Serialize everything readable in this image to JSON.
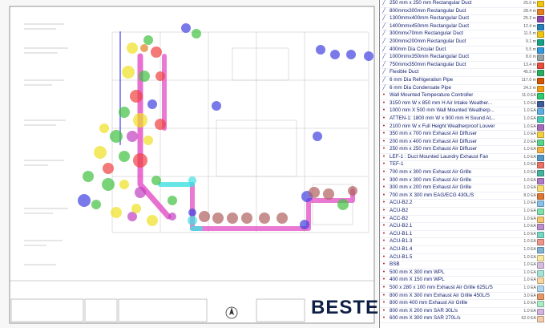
{
  "drawing": {
    "brand": "BESTE",
    "icons": [
      "north-arrow-icon"
    ],
    "marker_colors": [
      "#f0e020",
      "#f04040",
      "#40c040",
      "#4040e0",
      "#c040c0",
      "#40e0e0",
      "#e08020",
      "#a0a0a0",
      "#b06060"
    ]
  },
  "panel": {
    "items": [
      {
        "type": "line",
        "label": "250 mm x 250 mm Rectangular Duct",
        "qty": "25.0 m",
        "color": "#f1c40f"
      },
      {
        "type": "line",
        "label": "800mmx300mm Rectangular Duct",
        "qty": "28.4 m",
        "color": "#e67e22"
      },
      {
        "type": "line",
        "label": "1300mmx400mm Rectangular Duct",
        "qty": "25.3 m",
        "color": "#8e44ad"
      },
      {
        "type": "line",
        "label": "1400mmx450mm Rectangular Duct",
        "qty": "12.4 m",
        "color": "#2980b9"
      },
      {
        "type": "line",
        "label": "300mmx70mm Rectangular Duct",
        "qty": "11.5 m",
        "color": "#f1c40f"
      },
      {
        "type": "line",
        "label": "200mmx200mm Rectangular Duct",
        "qty": "9.1 m",
        "color": "#16a085"
      },
      {
        "type": "line",
        "label": "400mm Dia Circular Duct",
        "qty": "5.5 m",
        "color": "#3498db"
      },
      {
        "type": "line",
        "label": "1000mmx350mm Rectangular Duct",
        "qty": "8.0 m",
        "color": "#95a5a6"
      },
      {
        "type": "line",
        "label": "750mmx350mm Rectangular Duct",
        "qty": "13.4 m",
        "color": "#e74c3c"
      },
      {
        "type": "line",
        "label": "Flexible Duct",
        "qty": "45.5 m",
        "color": "#27ae60"
      },
      {
        "type": "line",
        "label": "6 mm Dia Refrigeration  Pipe",
        "qty": "117.0 m",
        "color": "#d35400"
      },
      {
        "type": "line",
        "label": "6 mm Dia Condensate Pipe",
        "qty": "24.2 m",
        "color": "#f39c12"
      },
      {
        "type": "count",
        "label": "Wall Mounted Temperature Controller",
        "qty": "11.0 EA",
        "color": "#2ecc71"
      },
      {
        "type": "count",
        "label": "3150 mm W x 850 mm H Air Intake Weather...",
        "qty": "1.0 EA",
        "color": "#3d5a99"
      },
      {
        "type": "count",
        "label": "1000 mm X 500 mm Wall Mounted Weatherp...",
        "qty": "1.0 EA",
        "color": "#5dade2"
      },
      {
        "type": "count",
        "label": "ATTEN-1: 1800 mm W x 900 mm H Sound At...",
        "qty": "1.0 EA",
        "color": "#48c9b0"
      },
      {
        "type": "count",
        "label": "2100 mm W x Full Height Weatherproof Louver",
        "qty": "1.0 EA",
        "color": "#a569bd"
      },
      {
        "type": "count",
        "label": "350 mm x 700 mm  Exhaust Air Diffuser",
        "qty": "1.0 EA",
        "color": "#f4d03f"
      },
      {
        "type": "count",
        "label": "200 mm x 400 mm  Exhaust Air Diffuser",
        "qty": "2.0 EA",
        "color": "#58d68d"
      },
      {
        "type": "count",
        "label": "250 mm x 250 mm  Exhaust Air Diffuser",
        "qty": "1.0 EA",
        "color": "#f5b041"
      },
      {
        "type": "count",
        "label": "LEF-1 : Duct Mounted Laundry Exhaust Fan",
        "qty": "1.0 EA",
        "color": "#5499c7"
      },
      {
        "type": "count",
        "label": "TEF-1",
        "qty": "1.0 EA",
        "color": "#ec7063"
      },
      {
        "type": "count",
        "label": "700 mm  x 300 mm  Exhaust Air Grille",
        "qty": "1.0 EA",
        "color": "#45b39d"
      },
      {
        "type": "count",
        "label": "300 mm  x 300 mm  Exhaust Air Grille",
        "qty": "1.0 EA",
        "color": "#af7ac5"
      },
      {
        "type": "count",
        "label": "300 mm  x 200 mm  Exhaust Air Grille",
        "qty": "1.0 EA",
        "color": "#f7dc6f"
      },
      {
        "type": "count",
        "label": "700 mm X 300 mm  EAG/ECG 430L/S",
        "qty": "8.0 EA",
        "color": "#dc7633"
      },
      {
        "type": "count",
        "label": "ACU-B2.2",
        "qty": "1.0 EA",
        "color": "#85c1e9"
      },
      {
        "type": "count",
        "label": "ACU-B2",
        "qty": "1.0 EA",
        "color": "#82e0aa"
      },
      {
        "type": "count",
        "label": "ACC-B2",
        "qty": "1.0 EA",
        "color": "#f8c471"
      },
      {
        "type": "count",
        "label": "ACU-B2.1",
        "qty": "1.0 EA",
        "color": "#bb8fce"
      },
      {
        "type": "count",
        "label": "ACU-B1.1",
        "qty": "1.0 EA",
        "color": "#76d7c4"
      },
      {
        "type": "count",
        "label": "ACU-B1.3",
        "qty": "1.0 EA",
        "color": "#f1948a"
      },
      {
        "type": "count",
        "label": "ACU-B1.4",
        "qty": "1.0 EA",
        "color": "#7fb3d5"
      },
      {
        "type": "count",
        "label": "ACU-B1.5",
        "qty": "1.0 EA",
        "color": "#f9e79f"
      },
      {
        "type": "count",
        "label": "BSB",
        "qty": "1.0 EA",
        "color": "#d7bde2"
      },
      {
        "type": "count",
        "label": "500 mm X 300 mm WPL",
        "qty": "1.0 EA",
        "color": "#a3e4d7"
      },
      {
        "type": "count",
        "label": "400 mm X 150 mm WPL",
        "qty": "1.0 EA",
        "color": "#fad7a0"
      },
      {
        "type": "count",
        "label": "500 x 280 x 100 mm Exhaust Air Grille 625L/S",
        "qty": "1.0 EA",
        "color": "#aed6f1"
      },
      {
        "type": "count",
        "label": "800 mm X 300 mm Exhaust Air Grille 450L/S",
        "qty": "3.0 EA",
        "color": "#e59866"
      },
      {
        "type": "count",
        "label": "800 mm 400 mm Exhaust Air Grille",
        "qty": "1.0 EA",
        "color": "#abebc6"
      },
      {
        "type": "count",
        "label": "800 mm X 200 mm SAR 30L/s",
        "qty": "1.0 EA",
        "color": "#d2b4de"
      },
      {
        "type": "count",
        "label": "600 mm X 300 mm SAR 270L/s",
        "qty": "62.0 EA",
        "color": "#f5cba7"
      }
    ]
  }
}
